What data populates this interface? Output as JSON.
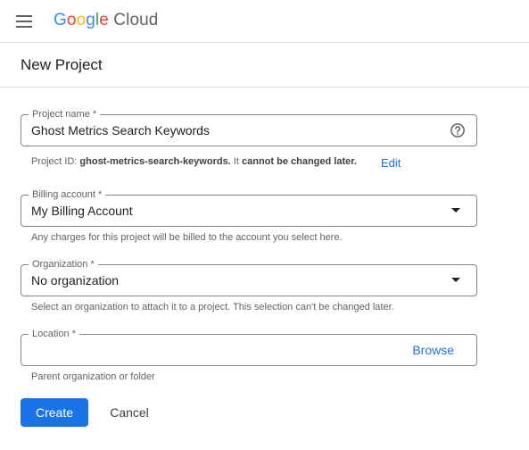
{
  "header": {
    "logo_google": [
      "G",
      "o",
      "o",
      "g",
      "l",
      "e"
    ],
    "logo_cloud": "Cloud",
    "menu_icon": "hamburger-menu-icon"
  },
  "page": {
    "title": "New Project"
  },
  "form": {
    "project_name": {
      "label": "Project name *",
      "value": "Ghost Metrics Search Keywords",
      "icon": "help-circle-icon"
    },
    "project_id": {
      "prefix": "Project ID: ",
      "id": "ghost-metrics-search-keywords.",
      "middle": " It ",
      "suffix": "cannot be changed later.",
      "edit_label": "Edit"
    },
    "billing_account": {
      "label": "Billing account *",
      "value": "My Billing Account",
      "helper": "Any charges for this project will be billed to the account you select here."
    },
    "organization": {
      "label": "Organization *",
      "value": "No organization",
      "helper": "Select an organization to attach it to a project. This selection can't be changed later."
    },
    "location": {
      "label": "Location *",
      "value": "",
      "browse_label": "Browse",
      "helper": "Parent organization or folder"
    }
  },
  "actions": {
    "create_label": "Create",
    "cancel_label": "Cancel"
  },
  "colors": {
    "primary": "#1a73e8",
    "border": "#80868b",
    "divider": "#dadce0"
  }
}
